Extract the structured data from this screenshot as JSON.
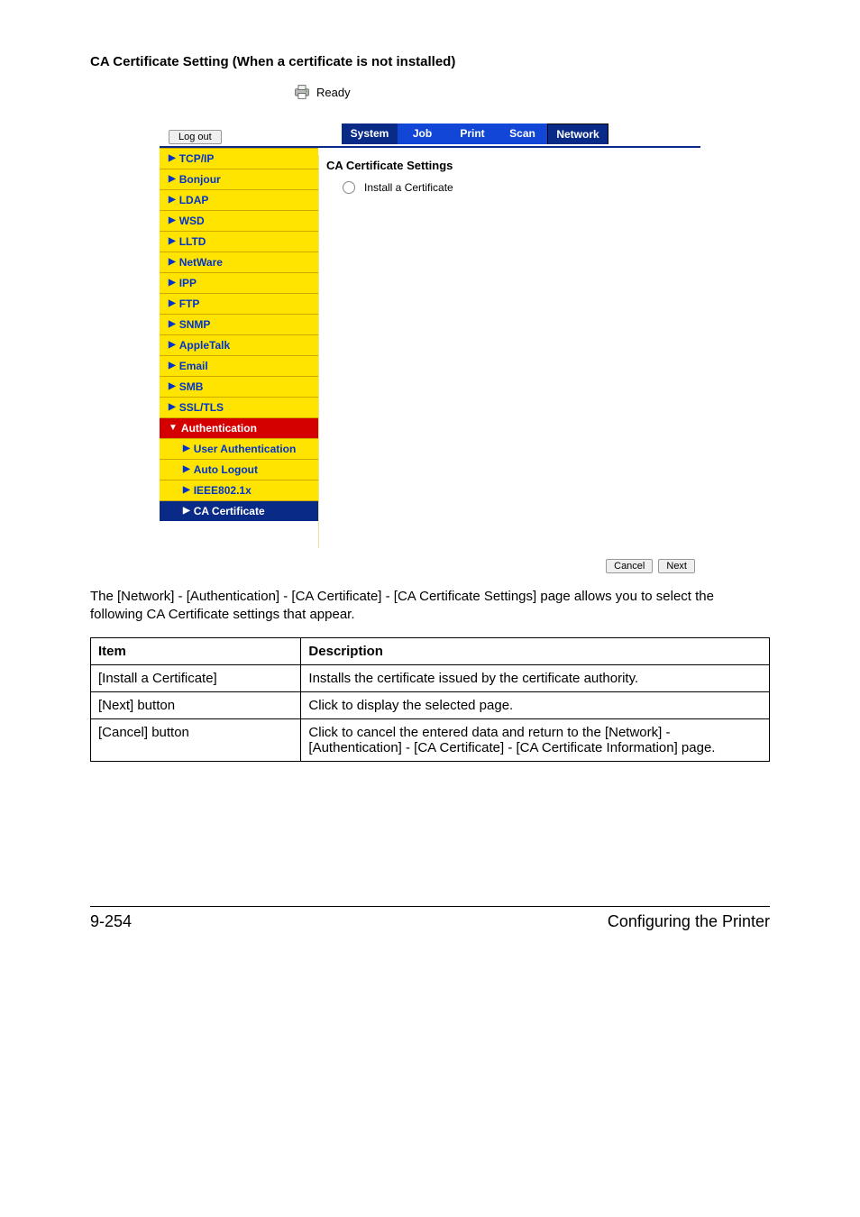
{
  "section_title": "CA Certificate Setting (When a certificate is not installed)",
  "ready_label": "Ready",
  "logout_label": "Log out",
  "tabs": {
    "system": "System",
    "job": "Job",
    "print": "Print",
    "scan": "Scan",
    "network": "Network"
  },
  "sidebar": {
    "tcpip": "TCP/IP",
    "bonjour": "Bonjour",
    "ldap": "LDAP",
    "wsd": "WSD",
    "lltd": "LLTD",
    "netware": "NetWare",
    "ipp": "IPP",
    "ftp": "FTP",
    "snmp": "SNMP",
    "appletalk": "AppleTalk",
    "email": "Email",
    "smb": "SMB",
    "ssltls": "SSL/TLS",
    "auth_header": "Authentication",
    "user_auth": "User Authentication",
    "auto_logout": "Auto Logout",
    "ieee": "IEEE802.1x",
    "ca_cert": "CA Certificate"
  },
  "main": {
    "title": "CA Certificate Settings",
    "install_label": "Install a Certificate"
  },
  "buttons": {
    "cancel": "Cancel",
    "next": "Next"
  },
  "paragraph": "The [Network] - [Authentication] - [CA Certificate] - [CA Certificate Settings] page allows you to select the following CA Certificate settings that appear.",
  "table": {
    "head_item": "Item",
    "head_desc": "Description",
    "rows": [
      {
        "item": "[Install a Certificate]",
        "desc": "Installs the certificate issued by the certificate authority."
      },
      {
        "item": "[Next] button",
        "desc": "Click to display the selected page."
      },
      {
        "item": "[Cancel] button",
        "desc": "Click to cancel the entered data and return to the [Network] - [Authentication] - [CA Certificate] - [CA Certificate Information] page."
      }
    ]
  },
  "footer": {
    "left": "9-254",
    "right": "Configuring the Printer"
  }
}
